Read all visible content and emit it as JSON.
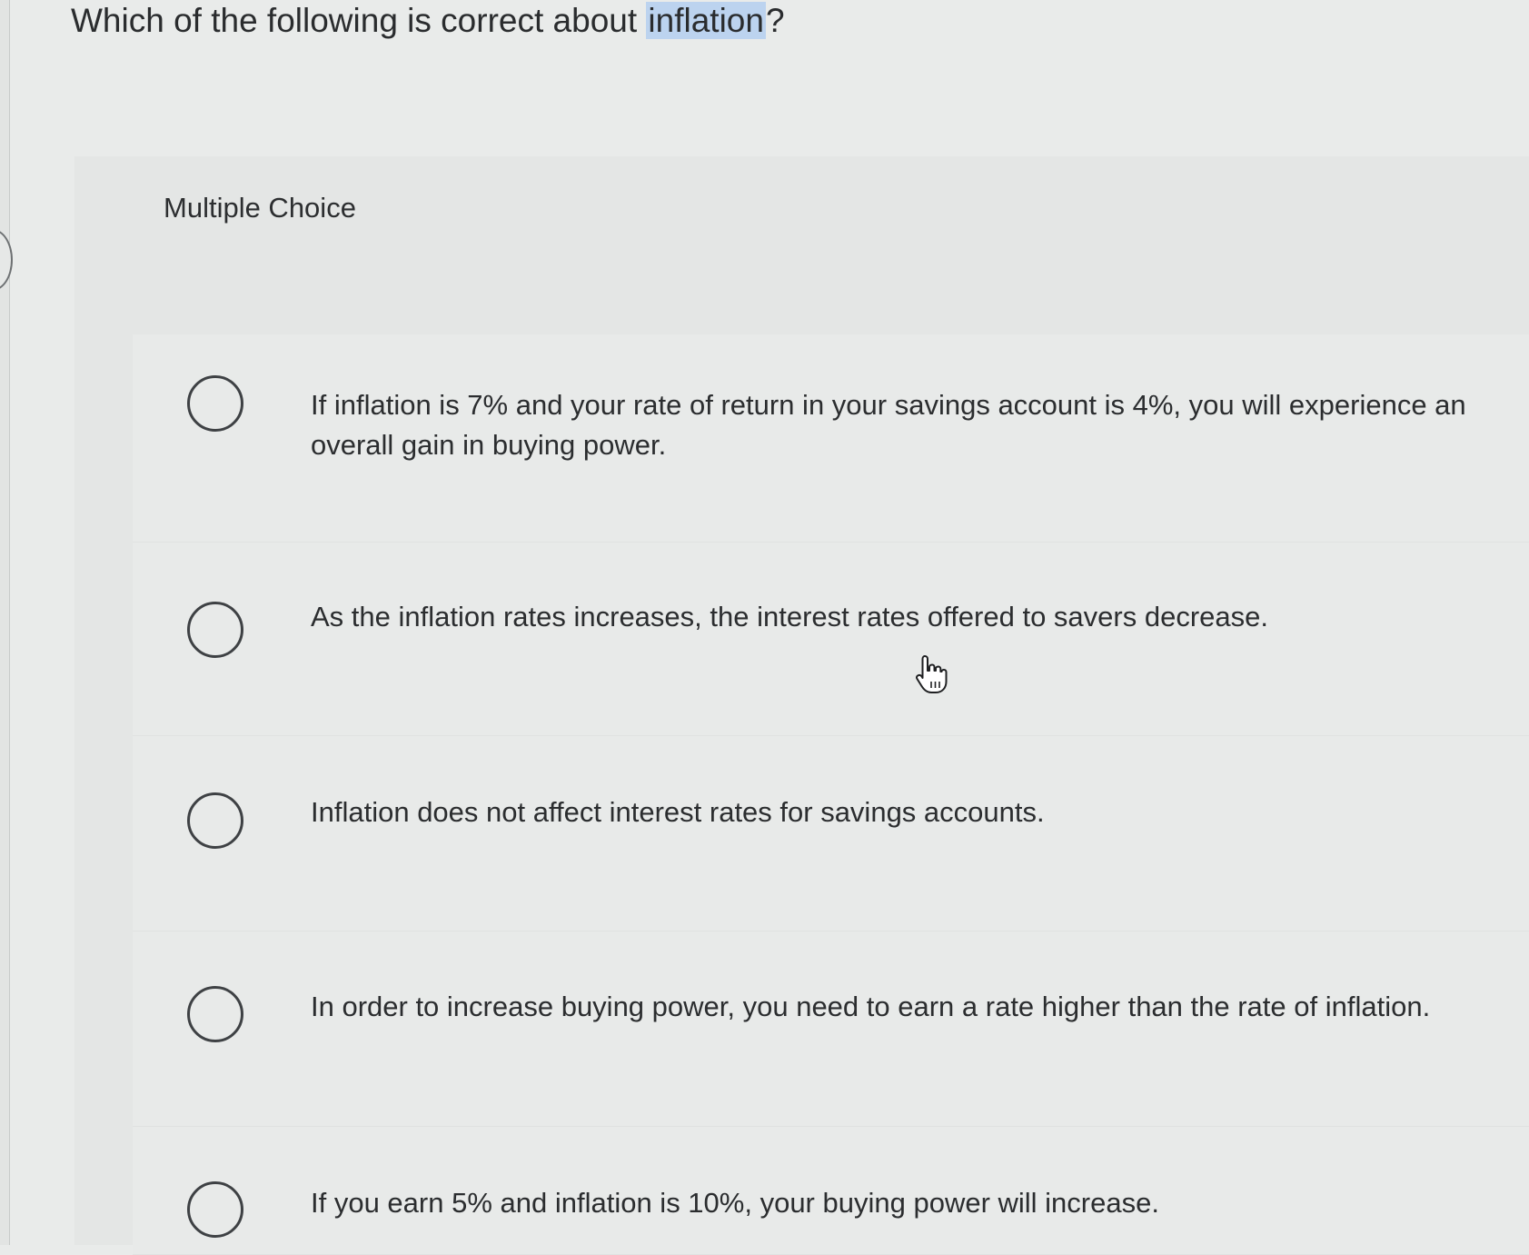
{
  "question": {
    "prefix": "Which of the following is correct about ",
    "highlighted_word": "inflation",
    "suffix": "?"
  },
  "section_label": "Multiple Choice",
  "choices": [
    {
      "text": "If inflation is 7% and your rate of return in your savings account is 4%, you will experience an overall gain in buying power."
    },
    {
      "text": "As the inflation rates increases, the interest rates offered to savers decrease."
    },
    {
      "text": "Inflation does not affect interest rates for savings accounts."
    },
    {
      "text": "In order to increase buying power, you need to earn a rate higher than the rate of inflation."
    },
    {
      "text": "If you earn 5% and inflation is 10%, your buying power will increase."
    }
  ],
  "selected_choice": null,
  "icons": {
    "cursor": "hand-pointer-icon",
    "choice_marker": "radio-button-icon"
  },
  "colors": {
    "highlight": "#bcd3ef",
    "background": "#e9ebea",
    "text": "#2b2d2f"
  }
}
